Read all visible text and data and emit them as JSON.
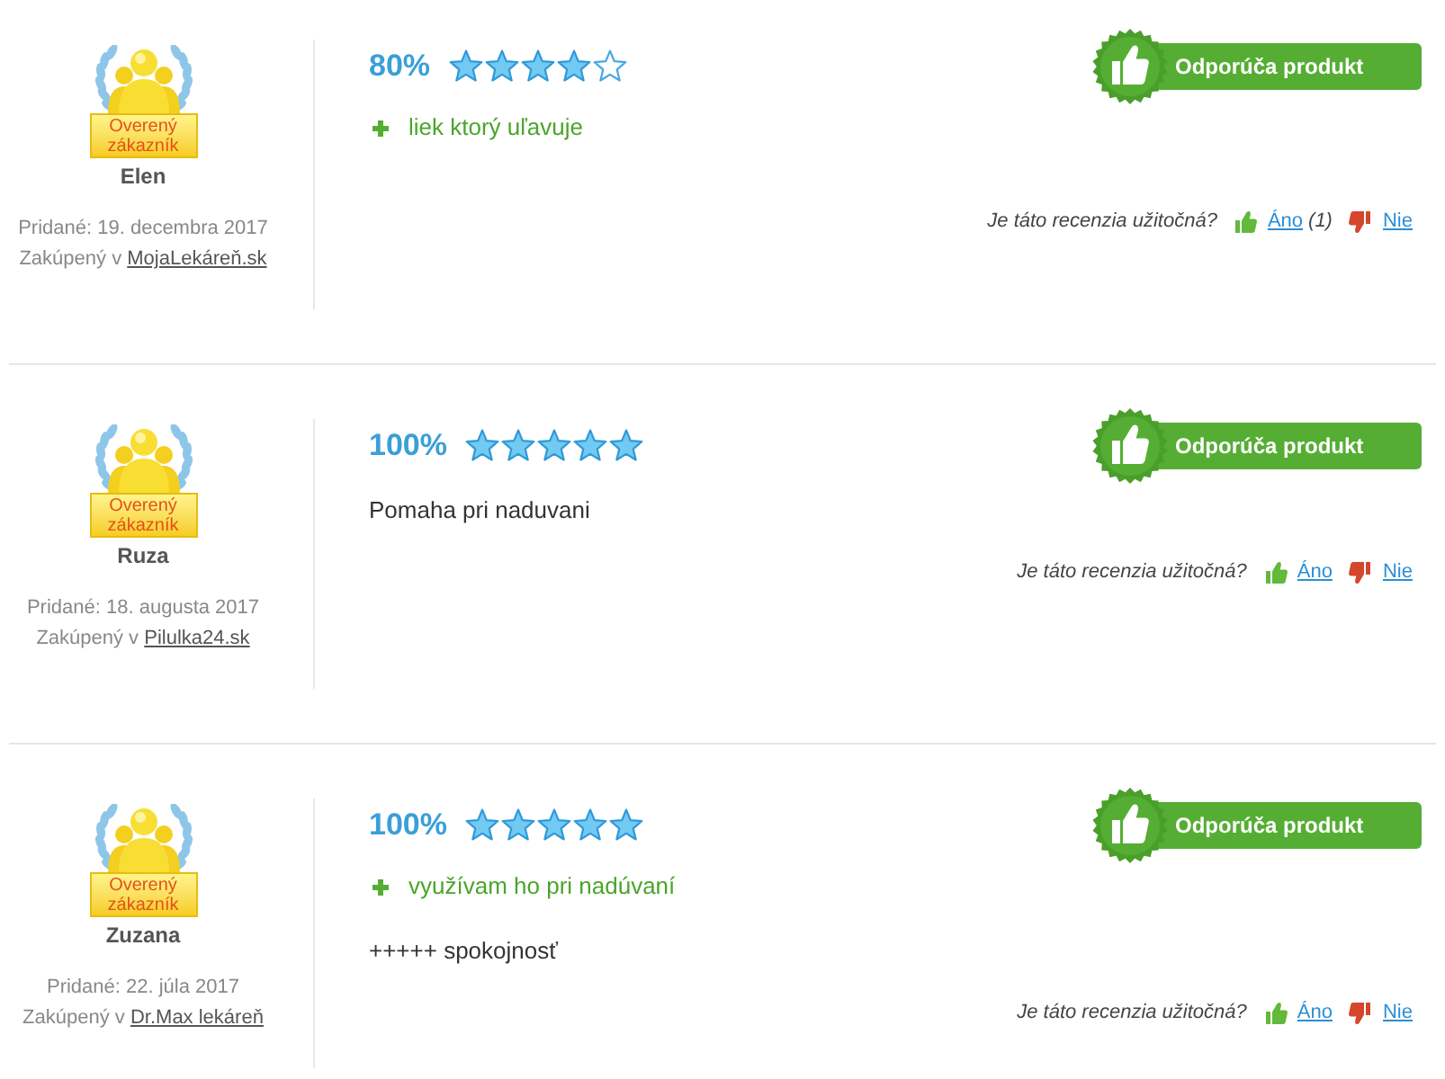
{
  "reviews": [
    {
      "verified_badge": "Overený zákazník",
      "author": "Elen",
      "added": "Pridané: 19. decembra 2017",
      "purchased_label": "Zakúpený v",
      "purchased_store": "MojaLekáreň.sk",
      "rating": "80%",
      "stars": 4,
      "recommended": true,
      "recommend_label": "Odporúča produkt",
      "pros": [
        "liek ktorý uľavuje"
      ],
      "helpful": {
        "question": "Je táto recenzia užitočná?",
        "yes": "Áno",
        "yes_count": "(1)",
        "no": "Nie"
      }
    },
    {
      "verified_badge": "Overený zákazník",
      "author": "Ruza",
      "added": "Pridané: 18. augusta 2017",
      "purchased_label": "Zakúpený v",
      "purchased_store": "Pilulka24.sk",
      "rating": "100%",
      "stars": 5,
      "recommended": true,
      "recommend_label": "Odporúča produkt",
      "text": "Pomaha pri naduvani",
      "helpful": {
        "question": "Je táto recenzia užitočná?",
        "yes": "Áno",
        "no": "Nie"
      }
    },
    {
      "verified_badge": "Overený zákazník",
      "author": "Zuzana",
      "added": "Pridané: 22. júla 2017",
      "purchased_label": "Zakúpený v",
      "purchased_store": "Dr.Max lekáreň",
      "rating": "100%",
      "stars": 5,
      "recommended": true,
      "recommend_label": "Odporúča produkt",
      "pros": [
        "využívam ho pri nadúvaní"
      ],
      "text": "+++++ spokojnosť",
      "helpful": {
        "question": "Je táto recenzia užitočná?",
        "yes": "Áno",
        "no": "Nie"
      }
    }
  ]
}
